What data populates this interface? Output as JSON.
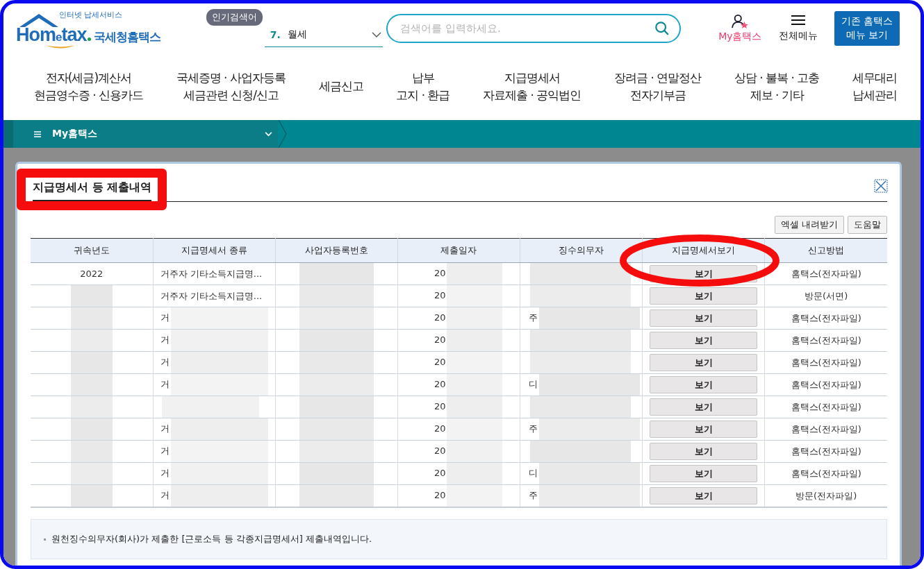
{
  "header": {
    "logo": {
      "wordmark_left": "Hom",
      "wordmark_e": "e",
      "wordmark_right": "tax",
      "tagline": "인터넷 납세서비스",
      "agency": "국세청홈택스"
    },
    "popular": {
      "badge": "인기검색어",
      "rank": "7.",
      "term": "월세"
    },
    "search": {
      "placeholder": "검색어를 입력하세요."
    },
    "my_link": "My홈택스",
    "all_menu": "전체메뉴",
    "legacy_button": [
      "기존 홈택스",
      "메뉴 보기"
    ]
  },
  "nav": [
    {
      "lines": [
        "전자(세금)계산서",
        "현금영수증 · 신용카드"
      ]
    },
    {
      "lines": [
        "국세증명 · 사업자등록",
        "세금관련 신청/신고"
      ]
    },
    {
      "lines": [
        "세금신고"
      ]
    },
    {
      "lines": [
        "납부",
        "고지 · 환급"
      ]
    },
    {
      "lines": [
        "지급명세서",
        "자료제출 · 공익법인"
      ]
    },
    {
      "lines": [
        "장려금 · 연말정산",
        "전자기부금"
      ]
    },
    {
      "lines": [
        "상담 · 불복 · 고충",
        "제보 · 기타"
      ]
    },
    {
      "lines": [
        "세무대리",
        "납세관리"
      ]
    }
  ],
  "breadcrumb": {
    "label": "My홈택스"
  },
  "panel": {
    "title": "지급명세서 등 제출내역",
    "buttons": [
      "엑셀 내려받기",
      "도움말"
    ],
    "table": {
      "columns": [
        "귀속년도",
        "지급명세서 종류",
        "사업자등록번호",
        "제출일자",
        "징수의무자",
        "지급명세서보기",
        "신고방법"
      ],
      "rows": [
        {
          "year": "2022",
          "type": "거주자 기타소득지급명...",
          "date": "20",
          "view": "보기",
          "method": "홈택스(전자파일)"
        },
        {
          "type": "거주자 기타소득지급명...",
          "date": "20",
          "view": "보기",
          "method": "방문(서면)"
        },
        {
          "type": "거",
          "date": "20",
          "payer": "주",
          "view": "보기",
          "method": "홈택스(전자파일)"
        },
        {
          "type": "거",
          "date": "20",
          "view": "보기",
          "method": "홈택스(전자파일)"
        },
        {
          "type": "거",
          "date": "20",
          "view": "보기",
          "method": "홈택스(전자파일)"
        },
        {
          "type": "거",
          "date": "20",
          "payer": "디",
          "view": "보기",
          "method": "홈택스(전자파일)"
        },
        {
          "date": "20",
          "view": "보기",
          "method": "홈택스(전자파일)"
        },
        {
          "type": "거",
          "date": "20",
          "payer": "주",
          "view": "보기",
          "method": "홈택스(전자파일)"
        },
        {
          "type": "거",
          "date": "20",
          "view": "보기",
          "method": "홈택스(전자파일)"
        },
        {
          "type": "거",
          "date": "20",
          "payer": "디",
          "view": "보기",
          "method": "홈택스(전자파일)"
        },
        {
          "type": "거",
          "date": "20",
          "payer": "주",
          "view": "보기",
          "method": "방문(전자파일)"
        }
      ]
    },
    "note": "원천징수의무자(회사)가 제출한 [근로소득 등 각종지급명세서] 제출내역입니다."
  }
}
